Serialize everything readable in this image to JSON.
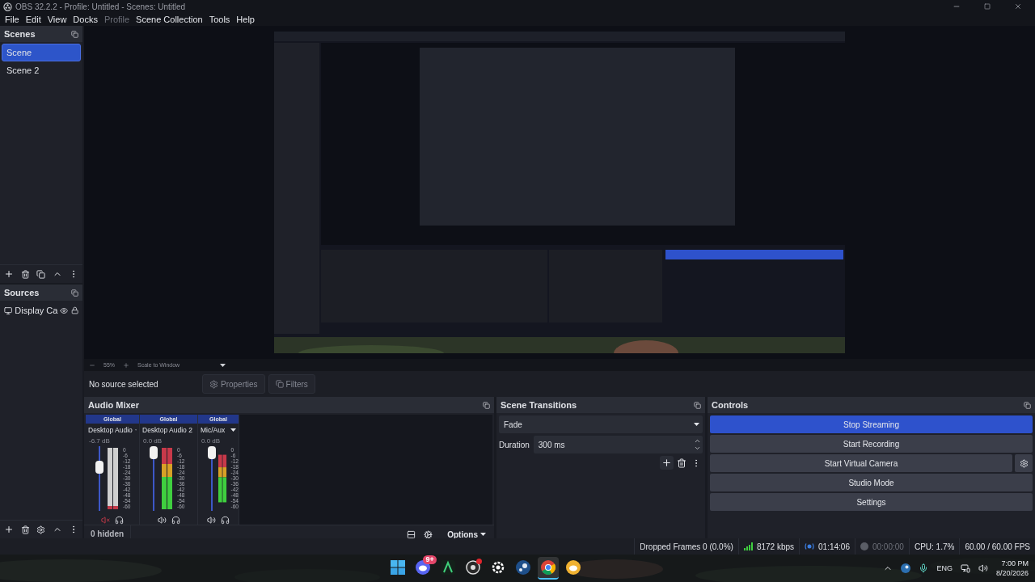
{
  "window": {
    "title": "OBS 32.2.2 - Profile: Untitled - Scenes: Untitled"
  },
  "menu": [
    {
      "label": "File",
      "disabled": false
    },
    {
      "label": "Edit",
      "disabled": false
    },
    {
      "label": "View",
      "disabled": false
    },
    {
      "label": "Docks",
      "disabled": false
    },
    {
      "label": "Profile",
      "disabled": true
    },
    {
      "label": "Scene Collection",
      "disabled": false
    },
    {
      "label": "Tools",
      "disabled": false
    },
    {
      "label": "Help",
      "disabled": false
    }
  ],
  "scenes": {
    "title": "Scenes",
    "items": [
      {
        "label": "Scene",
        "selected": true
      },
      {
        "label": "Scene 2",
        "selected": false
      }
    ]
  },
  "sources": {
    "title": "Sources",
    "items": [
      {
        "label": "Display Ca",
        "visible": true,
        "locked": true
      }
    ]
  },
  "zoom_bar": {
    "zoom": "55%",
    "scale_mode": "Scale to Window"
  },
  "context_bar": {
    "status": "No source selected",
    "properties": "Properties",
    "filters": "Filters"
  },
  "audio_mixer": {
    "title": "Audio Mixer",
    "hidden": "0 hidden",
    "options": "Options",
    "channels": [
      {
        "mode": "Global",
        "name": "Desktop Audio",
        "reading": "-6.7 dB",
        "level": 0.72,
        "muted": true,
        "scale": [
          "0",
          "-6",
          "-12",
          "-18",
          "-24",
          "-30",
          "-36",
          "-42",
          "-48",
          "-54",
          "-60"
        ]
      },
      {
        "mode": "Global",
        "name": "Desktop Audio 2",
        "reading": "0.0 dB",
        "level": 1,
        "muted": false,
        "scale": [
          "0",
          "-6",
          "-12",
          "-18",
          "-24",
          "-30",
          "-36",
          "-42",
          "-48",
          "-54",
          "-60"
        ]
      },
      {
        "mode": "Global",
        "name": "Mic/Aux",
        "reading": "0.0 dB",
        "level": 1,
        "muted": false,
        "scale": [
          "0",
          "-6",
          "-12",
          "-18",
          "-24",
          "-30",
          "-36",
          "-42",
          "-48",
          "-54",
          "-60"
        ]
      }
    ]
  },
  "scene_transitions": {
    "title": "Scene Transitions",
    "transition": "Fade",
    "duration_label": "Duration",
    "duration": "300 ms"
  },
  "controls": {
    "title": "Controls",
    "buttons": [
      {
        "label": "Stop Streaming",
        "active": true
      },
      {
        "label": "Start Recording",
        "active": false
      },
      {
        "label": "Start Virtual Camera",
        "active": false
      },
      {
        "label": "Studio Mode",
        "active": false
      },
      {
        "label": "Settings",
        "active": false
      }
    ]
  },
  "status_bar": {
    "dropped_frames": "Dropped Frames 0 (0.0%)",
    "bitrate": "8172 kbps",
    "stream_time": "01:14:06",
    "recording": false,
    "record_time": "00:00:00",
    "cpu": "CPU: 1.7%",
    "fps": "60.00 / 60.00 FPS"
  },
  "taskbar": {
    "apps": [
      {
        "kind": "start",
        "active": false
      },
      {
        "kind": "discord",
        "active": false,
        "badge": "9+"
      },
      {
        "kind": "launcher",
        "active": false
      },
      {
        "kind": "obs",
        "active": false,
        "dot": true
      },
      {
        "kind": "steelseries",
        "active": false
      },
      {
        "kind": "steam",
        "active": false
      },
      {
        "kind": "chrome",
        "active": true
      },
      {
        "kind": "discord-alt",
        "active": false
      }
    ],
    "language": "ENG",
    "time": "7:00 PM",
    "date": "8/20/2026"
  }
}
